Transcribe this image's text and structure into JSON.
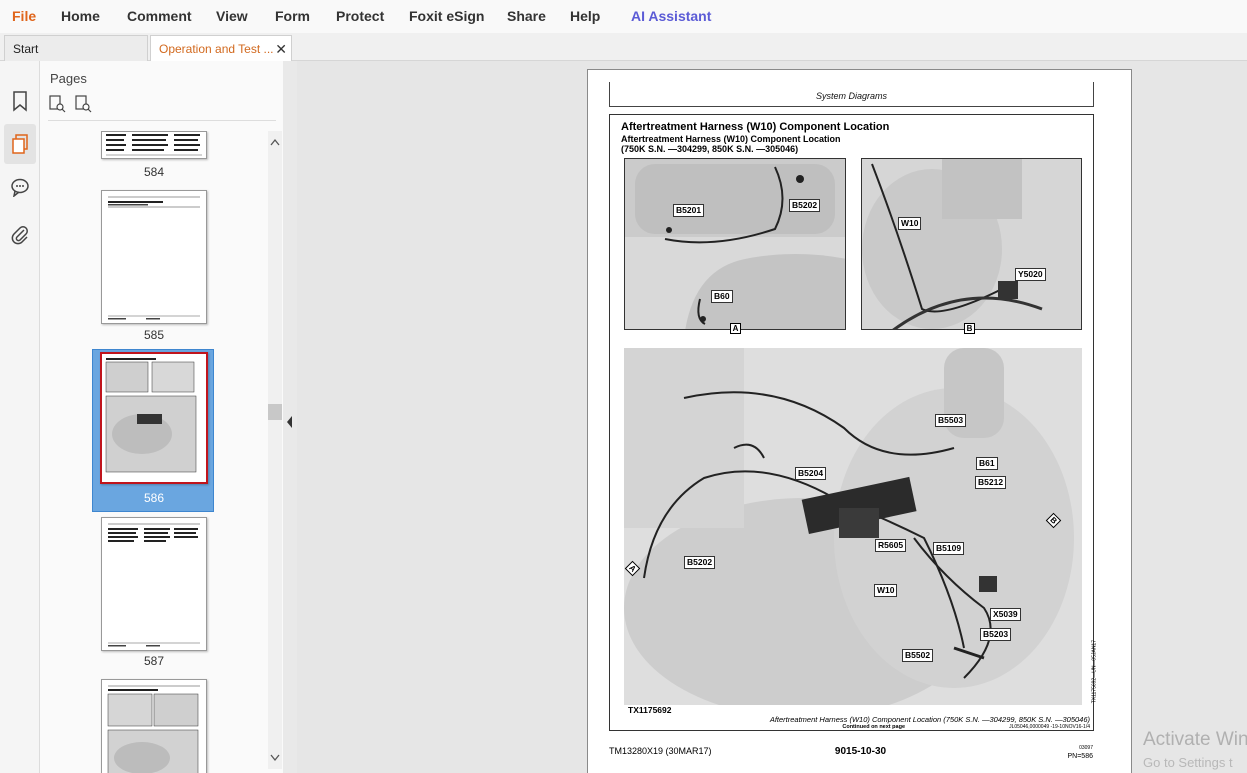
{
  "menu": {
    "items": [
      "File",
      "Home",
      "Comment",
      "View",
      "Form",
      "Protect",
      "Foxit eSign",
      "Share",
      "Help",
      "AI Assistant"
    ]
  },
  "tabs": [
    {
      "label": "Start"
    },
    {
      "label": "Operation and Test ..."
    }
  ],
  "sidebar": {
    "title": "Pages",
    "icons": [
      "bookmark-icon",
      "pages-icon",
      "comments-icon",
      "attachment-icon"
    ]
  },
  "thumbnails": [
    {
      "label": "584"
    },
    {
      "label": "585"
    },
    {
      "label": "586",
      "selected": true
    },
    {
      "label": "587"
    }
  ],
  "document": {
    "running_header": "System Diagrams",
    "title": "Aftertreatment Harness (W10) Component Location",
    "subtitle": "Aftertreatment Harness (W10) Component Location",
    "subtitle2": "(750K S.N. —304299, 850K S.N. —305046)",
    "panel_a_callouts": [
      "B5201",
      "B5202",
      "B60"
    ],
    "panel_b_callouts": [
      "W10",
      "Y5020"
    ],
    "panel_letters": [
      "A",
      "B"
    ],
    "main_callouts": [
      "B5503",
      "B61",
      "B5212",
      "B5204",
      "R5605",
      "B5109",
      "B5202",
      "W10",
      "X5039",
      "B5203",
      "B5502"
    ],
    "view_markers": [
      "A",
      "B"
    ],
    "figure_id": "TX1175692",
    "side_ref": "TX1175692—UN—05JAN17",
    "caption": "Aftertreatment Harness (W10) Component Location (750K S.N. —304299, 850K S.N. —305046)",
    "continued": "Continued on next page",
    "ref_code": "JL05046,0000049 -19-10NOV16-1/4",
    "footer_left": "TM13280X19 (30MAR17)",
    "footer_center": "9015-10-30",
    "footer_right_small": "03097",
    "footer_right": "PN=586"
  },
  "watermark": {
    "line1": "Activate Win",
    "line2": "Go to Settings t"
  },
  "colors": {
    "accent": "#e0651b",
    "ai": "#5b5bd6",
    "selection": "#6aa6e0"
  }
}
